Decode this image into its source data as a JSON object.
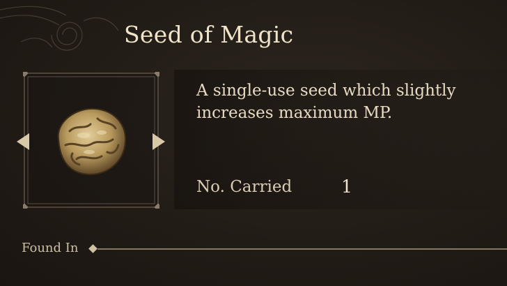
{
  "item": {
    "name": "Seed of Magic",
    "description": "A single-use seed which slightly increases maximum MP.",
    "carried_label": "No. Carried",
    "carried_count": "1"
  },
  "found_in": {
    "label": "Found In"
  },
  "icons": {
    "prev": "arrow-left-icon",
    "next": "arrow-right-icon",
    "item": "seed-icon"
  },
  "colors": {
    "background": "#221c17",
    "text": "#e8dcc4",
    "accent_gold": "#d8c9a7"
  }
}
